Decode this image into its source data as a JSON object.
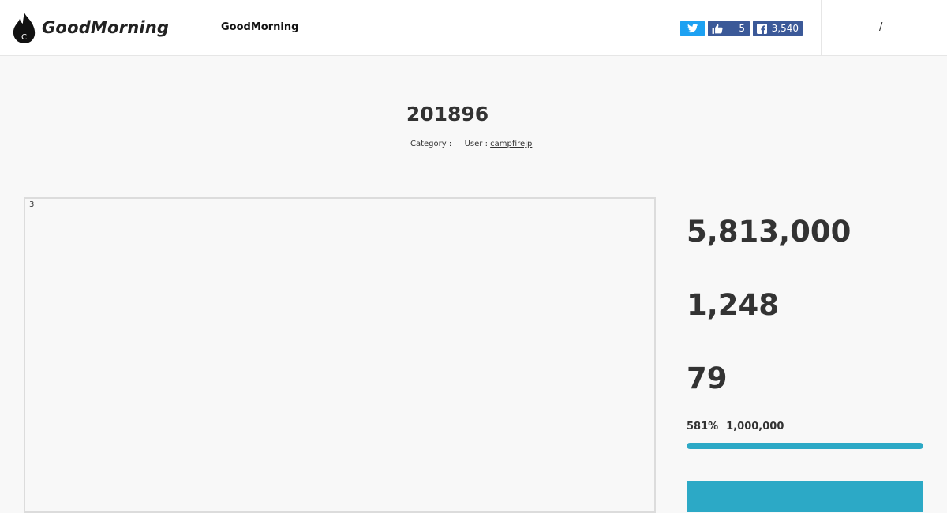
{
  "header": {
    "brand": "GoodMorning",
    "logo_letter": "C",
    "nav_title": "GoodMorning",
    "twitter_icon": "twitter-bird-icon",
    "likes": "5",
    "facebook_shares": "3,540",
    "right_text": "/"
  },
  "project": {
    "title": "201896",
    "category_label": "Category :",
    "user_label": "User :",
    "user_name": "campfirejp",
    "image_counter": "3"
  },
  "stats": {
    "amount": "5,813,000",
    "supporters": "1,248",
    "days_left": "79",
    "progress_percent_text": "581%",
    "goal": "1,000,000",
    "progress_fraction": 1.0
  },
  "colors": {
    "accent": "#2ca9c6",
    "twitter": "#1da1f2",
    "facebook": "#3b5998"
  }
}
